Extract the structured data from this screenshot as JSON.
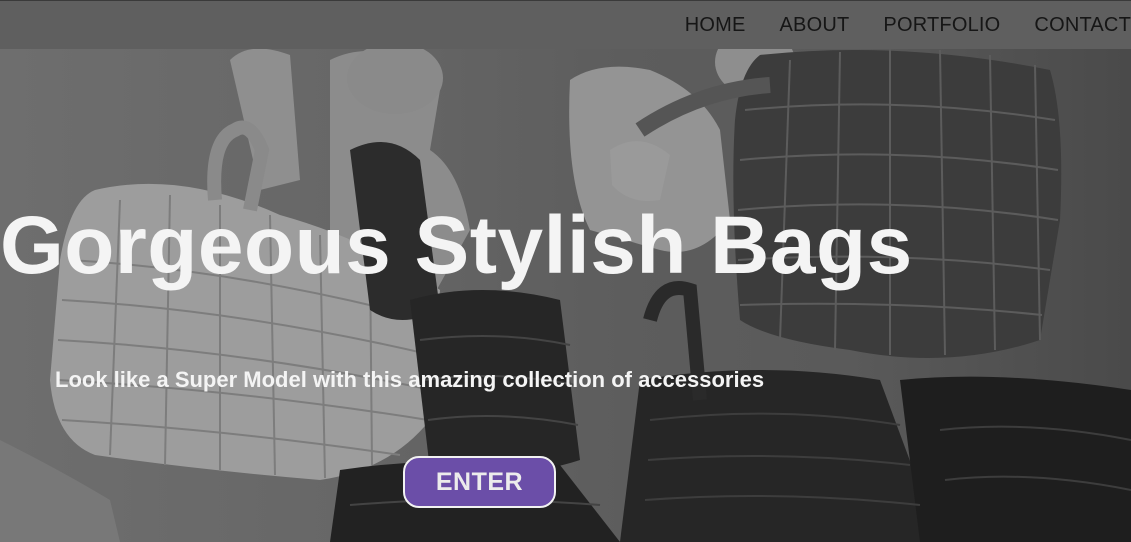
{
  "nav": {
    "items": [
      {
        "label": "HOME"
      },
      {
        "label": "ABOUT"
      },
      {
        "label": "PORTFOLIO"
      },
      {
        "label": "CONTACT"
      }
    ]
  },
  "hero": {
    "title": "Gorgeous Stylish Bags",
    "subtitle": "Look like a Super Model with this amazing collection of accessories",
    "cta_label": "ENTER",
    "colors": {
      "overlay": "#5f5f5f",
      "text": "#f4f4f4",
      "cta_background": "#6b4ea8",
      "cta_border": "#f2f2f2",
      "nav_text": "#161616"
    }
  }
}
